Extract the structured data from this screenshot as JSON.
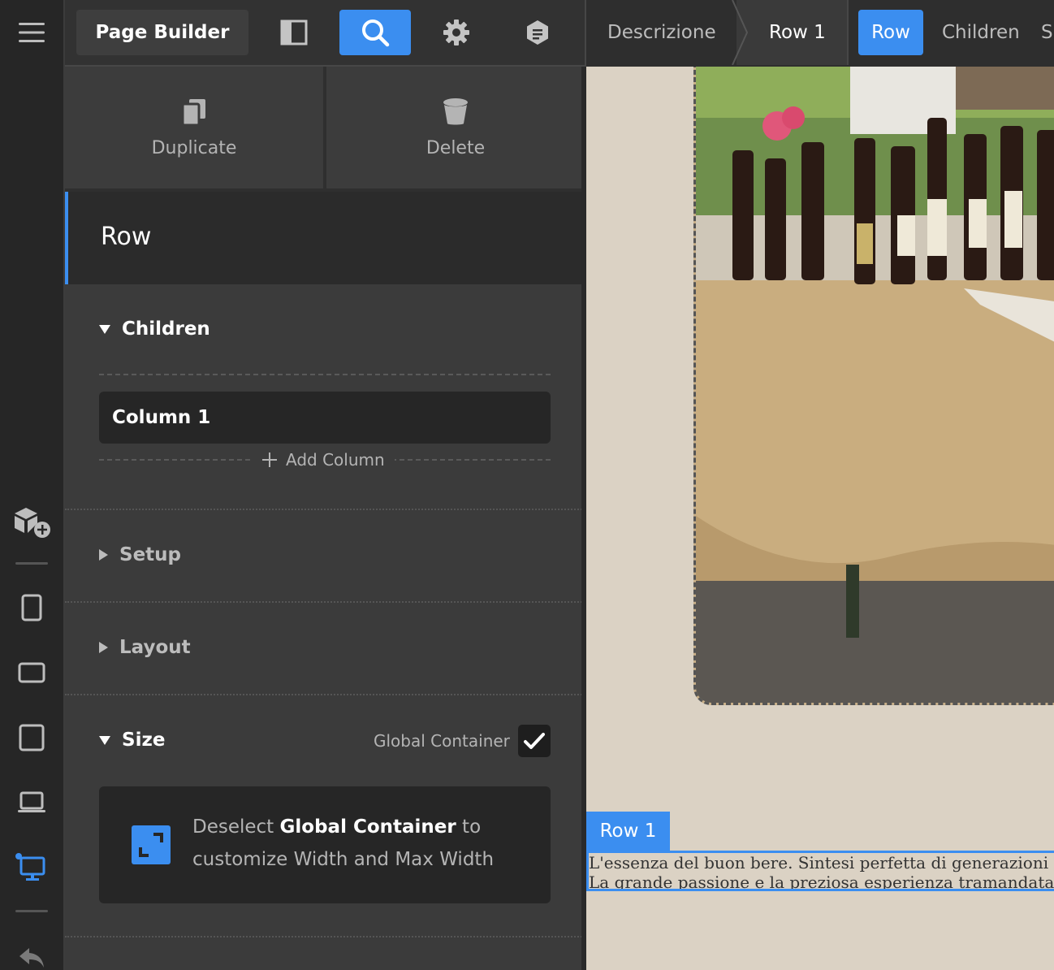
{
  "toolbar": {
    "page_builder_label": "Page Builder",
    "icons": [
      "layout-panel-icon",
      "search-icon",
      "gear-icon",
      "notes-icon"
    ]
  },
  "breadcrumb": {
    "items": [
      "Descrizione",
      "Row 1"
    ],
    "tabs": [
      "Row",
      "Children",
      "S"
    ]
  },
  "actions": {
    "duplicate_label": "Duplicate",
    "delete_label": "Delete"
  },
  "panel": {
    "title": "Row",
    "children": {
      "title": "Children",
      "items": [
        "Column 1"
      ],
      "add_label": "Add Column"
    },
    "setup_title": "Setup",
    "layout_title": "Layout",
    "size": {
      "title": "Size",
      "global_container_label": "Global Container",
      "global_container_checked": true,
      "note_prefix": "Deselect ",
      "note_bold": "Global Container",
      "note_suffix": " to customize Width and Max Width"
    }
  },
  "canvas": {
    "row_tag": "Row 1",
    "text_line_1": "L'essenza del buon bere. Sintesi perfetta di generazioni di vigna",
    "text_line_2": "La grande passione e la preziosa esperienza tramandata dai no"
  },
  "colors": {
    "accent": "#3b8ef0",
    "panel_bg": "#3b3b3b",
    "canvas_bg": "#dbd2c4"
  }
}
